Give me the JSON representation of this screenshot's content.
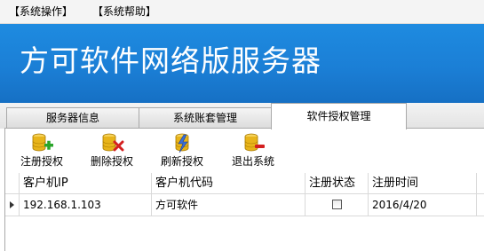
{
  "menu": {
    "items": [
      {
        "label": "【系统操作】"
      },
      {
        "label": "【系统帮助】"
      }
    ]
  },
  "banner": {
    "title": "方可软件网络版服务器"
  },
  "tabs": [
    {
      "label": "服务器信息",
      "active": false
    },
    {
      "label": "系统账套管理",
      "active": false
    },
    {
      "label": "软件授权管理",
      "active": true
    }
  ],
  "toolbar": {
    "buttons": [
      {
        "label": "注册授权",
        "icon": "database-add-icon"
      },
      {
        "label": "删除授权",
        "icon": "database-delete-icon"
      },
      {
        "label": "刷新授权",
        "icon": "database-refresh-icon"
      },
      {
        "label": "退出系统",
        "icon": "database-exit-icon"
      }
    ]
  },
  "grid": {
    "columns": [
      "客户机IP",
      "客户机代码",
      "注册状态",
      "注册时间"
    ],
    "rows": [
      {
        "ip": "192.168.1.103",
        "code": "方可软件",
        "registered": false,
        "time": "2016/4/20"
      }
    ]
  },
  "colors": {
    "banner_blue": "#1b7fd6",
    "icon_gold": "#e8b41a",
    "add_green": "#2aa52a",
    "delete_red": "#d42020"
  }
}
